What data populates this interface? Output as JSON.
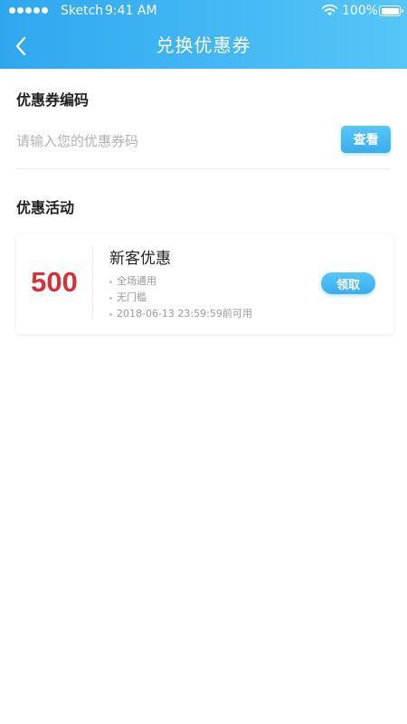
{
  "status_bar": {
    "carrier": "Sketch",
    "time": "9:41 AM",
    "battery": "100%"
  },
  "nav": {
    "title": "兑换优惠券",
    "back_icon": "chevron-left-icon"
  },
  "code_section": {
    "title": "优惠券编码",
    "input_placeholder": "请输入您的优惠券码",
    "input_value": "",
    "check_button": "查看"
  },
  "activity_section": {
    "title": "优惠活动",
    "coupons": [
      {
        "amount": "500",
        "name": "新客优惠",
        "details": [
          "全场通用",
          "无门槛",
          "2018-06-13 23:59:59前可用"
        ],
        "claim_button": "领取"
      }
    ]
  },
  "colors": {
    "header_gradient_start": "#2fa7f0",
    "header_gradient_end": "#55c6f7",
    "button_blue": "#38adee",
    "amount_red": "#d9313c"
  }
}
